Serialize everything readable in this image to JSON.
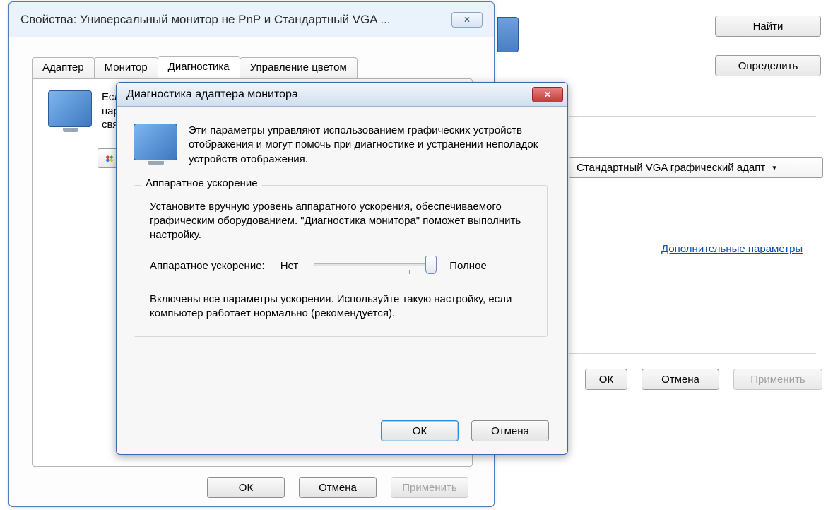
{
  "background": {
    "find": "Найти",
    "identify": "Определить",
    "dropdown": "Стандартный VGA графический адапт",
    "advanced_link": "Дополнительные параметры",
    "ok": "ОК",
    "cancel": "Отмена",
    "apply": "Применить"
  },
  "win1": {
    "title": "Свойства: Универсальный монитор не PnP и Стандартный VGA ...",
    "close_glyph": "✕",
    "tabs": {
      "adapter": "Адаптер",
      "monitor": "Монитор",
      "diagnostics": "Диагностика",
      "color_mgmt": "Управление цветом"
    },
    "panel_text_l1": "Есл",
    "panel_text_l2": "пар",
    "panel_text_l3": "свя",
    "ok": "ОК",
    "cancel": "Отмена",
    "apply": "Применить"
  },
  "win2": {
    "title": "Диагностика адаптера монитора",
    "close_glyph": "✕",
    "intro": "Эти параметры управляют использованием графических устройств отображения и могут помочь при диагностике и устранении неполадок устройств отображения.",
    "group_legend": "Аппаратное ускорение",
    "group_text1": "Установите вручную уровень аппаратного ускорения, обеспечиваемого графическим оборудованием. \"Диагностика монитора\" поможет выполнить настройку.",
    "slider_label": "Аппаратное ускорение:",
    "slider_min": "Нет",
    "slider_max": "Полное",
    "group_text2": "Включены все параметры ускорения. Используйте такую настройку, если компьютер работает нормально (рекомендуется).",
    "ok": "ОК",
    "cancel": "Отмена"
  }
}
